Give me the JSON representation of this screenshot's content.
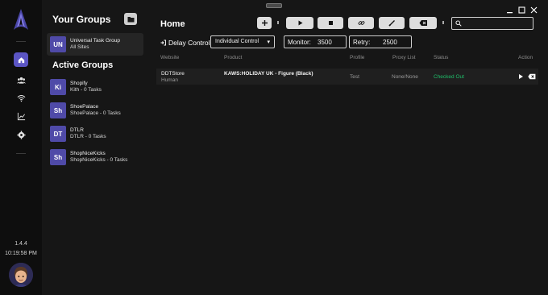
{
  "window": {
    "title": "Home"
  },
  "rail": {
    "nav": [
      {
        "name": "home",
        "icon": "home-icon",
        "active": true
      },
      {
        "name": "profiles",
        "icon": "users-icon",
        "active": false
      },
      {
        "name": "proxies",
        "icon": "wifi-icon",
        "active": false
      },
      {
        "name": "analytics",
        "icon": "chart-icon",
        "active": false
      },
      {
        "name": "settings",
        "icon": "gear-icon",
        "active": false
      }
    ],
    "version": "1.4.4",
    "time": "10:19:58 PM"
  },
  "groups": {
    "title": "Your Groups",
    "your_groups": [
      {
        "badge": "UN",
        "name": "Universal Task Group",
        "sub": "All Sites"
      }
    ],
    "active_title": "Active Groups",
    "active_groups": [
      {
        "badge": "Ki",
        "name": "Shopify",
        "sub": "Kith - 0 Tasks"
      },
      {
        "badge": "Sh",
        "name": "ShoePalace",
        "sub": "ShoePalace - 0 Tasks"
      },
      {
        "badge": "DT",
        "name": "DTLR",
        "sub": "DTLR - 0 Tasks"
      },
      {
        "badge": "Sh",
        "name": "ShopNiceKicks",
        "sub": "ShopNiceKicks - 0 Tasks"
      }
    ]
  },
  "toolbar": {
    "delay_label": "Delay Controls",
    "delay_mode": "Individual Control",
    "monitor_label": "Monitor:",
    "monitor_value": "3500",
    "retry_label": "Retry:",
    "retry_value": "2500",
    "search_placeholder": ""
  },
  "table": {
    "headers": {
      "website": "Website",
      "product": "Product",
      "profile": "Profile",
      "proxy": "Proxy List",
      "status": "Status",
      "action": "Action"
    },
    "rows": [
      {
        "website": "DDTStore",
        "mode": "Human",
        "product": "KAWS:HOLIDAY UK - Figure (Black)",
        "profile": "Test",
        "proxy": "None/None",
        "status": "Checked Out"
      }
    ]
  },
  "colors": {
    "accent": "#5b55c4",
    "badge": "#4f4aa8",
    "status_success": "#1fbf6a",
    "background": "#161616",
    "rail": "#0e0e0e"
  }
}
